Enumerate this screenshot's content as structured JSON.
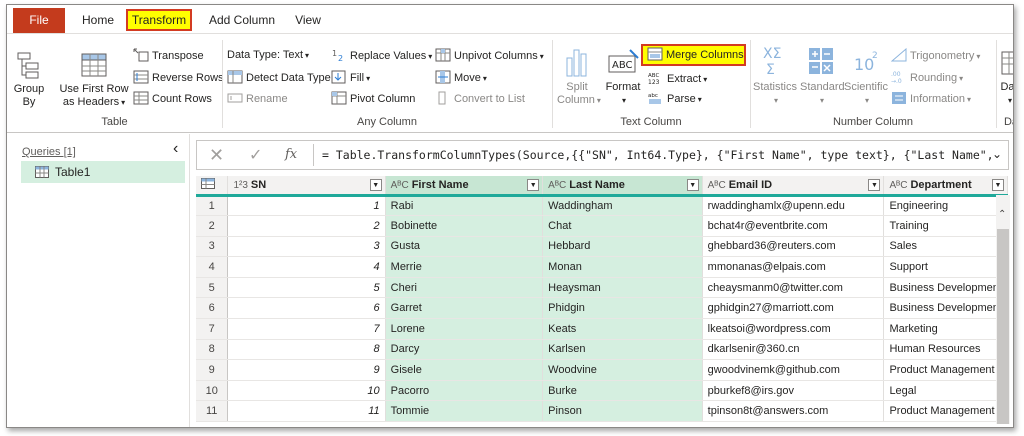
{
  "tabs": {
    "file": "File",
    "home": "Home",
    "transform": "Transform",
    "add_column": "Add Column",
    "view": "View"
  },
  "ribbon": {
    "table_group": {
      "label": "Table",
      "group_by": [
        "Group",
        "By"
      ],
      "use_first_row": [
        "Use First Row",
        "as Headers"
      ],
      "transpose": "Transpose",
      "reverse_rows": "Reverse Rows",
      "count_rows": "Count Rows"
    },
    "any_column_group": {
      "label": "Any Column",
      "data_type": "Data Type: Text",
      "detect_data_type": "Detect Data Type",
      "rename": "Rename",
      "replace_values": "Replace Values",
      "fill": "Fill",
      "pivot_column": "Pivot Column",
      "unpivot_columns": "Unpivot Columns",
      "move": "Move",
      "convert_to_list": "Convert to List"
    },
    "text_column_group": {
      "label": "Text Column",
      "split_column": [
        "Split",
        "Column"
      ],
      "format": "Format",
      "merge_columns": "Merge Columns",
      "extract": "Extract",
      "parse": "Parse"
    },
    "number_column_group": {
      "label": "Number Column",
      "statistics": "Statistics",
      "standard": "Standard",
      "scientific": "Scientific",
      "trigonometry": "Trigonometry",
      "rounding": "Rounding",
      "information": "Information"
    },
    "date_group": {
      "label": "Da",
      "date": "Dat"
    }
  },
  "queries": {
    "header": "Queries [1]",
    "items": [
      "Table1"
    ]
  },
  "formula_bar": {
    "fx": "fx",
    "formula": "= Table.TransformColumnTypes(Source,{{\"SN\", Int64.Type}, {\"First Name\", type text}, {\"Last Name\","
  },
  "grid": {
    "columns": [
      {
        "type": "1²3",
        "name": "SN"
      },
      {
        "type": "AᴮC",
        "name": "First Name"
      },
      {
        "type": "AᴮC",
        "name": "Last Name"
      },
      {
        "type": "AᴮC",
        "name": "Email ID"
      },
      {
        "type": "AᴮC",
        "name": "Department"
      }
    ],
    "rows": [
      [
        "1",
        "1",
        "Rabi",
        "Waddingham",
        "rwaddinghamlx@upenn.edu",
        "Engineering"
      ],
      [
        "2",
        "2",
        "Bobinette",
        "Chat",
        "bchat4r@eventbrite.com",
        "Training"
      ],
      [
        "3",
        "3",
        "Gusta",
        "Hebbard",
        "ghebbard36@reuters.com",
        "Sales"
      ],
      [
        "4",
        "4",
        "Merrie",
        "Monan",
        "mmonanas@elpais.com",
        "Support"
      ],
      [
        "5",
        "5",
        "Cheri",
        "Heaysman",
        "cheaysmanm0@twitter.com",
        "Business Development"
      ],
      [
        "6",
        "6",
        "Garret",
        "Phidgin",
        "gphidgin27@marriott.com",
        "Business Development"
      ],
      [
        "7",
        "7",
        "Lorene",
        "Keats",
        "lkeatsoi@wordpress.com",
        "Marketing"
      ],
      [
        "8",
        "8",
        "Darcy",
        "Karlsen",
        "dkarlsenir@360.cn",
        "Human Resources"
      ],
      [
        "9",
        "9",
        "Gisele",
        "Woodvine",
        "gwoodvinemk@github.com",
        "Product Management"
      ],
      [
        "10",
        "10",
        "Pacorro",
        "Burke",
        "pburkef8@irs.gov",
        "Legal"
      ],
      [
        "11",
        "11",
        "Tommie",
        "Pinson",
        "tpinson8t@answers.com",
        "Product Management"
      ]
    ]
  },
  "colors": {
    "file_tab": "#c43b1d",
    "highlight_yellow": "#fffe00",
    "highlight_border": "#d33b22",
    "selected_column": "#d5efe0",
    "header_accent": "#1fa99a"
  }
}
